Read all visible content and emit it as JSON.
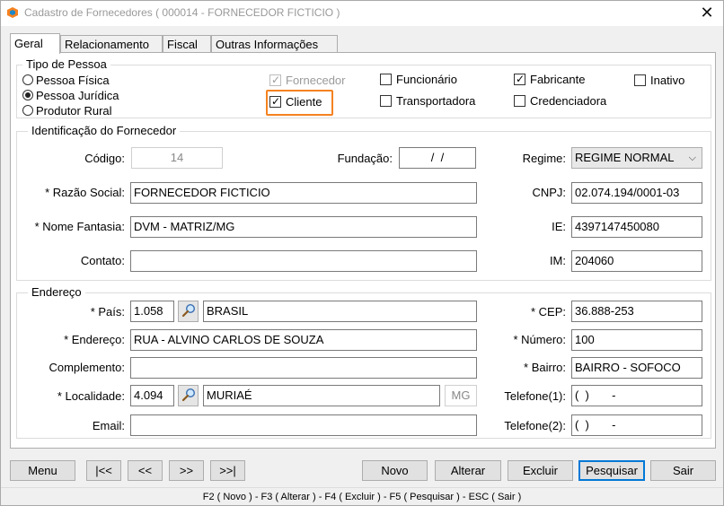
{
  "window": {
    "title": "Cadastro de Fornecedores ( 000014 - FORNECEDOR FICTICIO )"
  },
  "tabs": [
    {
      "label": "Geral",
      "active": true
    },
    {
      "label": "Relacionamento",
      "active": false
    },
    {
      "label": "Fiscal",
      "active": false
    },
    {
      "label": "Outras Informações",
      "active": false
    }
  ],
  "tipo_pessoa": {
    "legend": "Tipo de Pessoa",
    "options": [
      {
        "label": "Pessoa Física",
        "selected": false
      },
      {
        "label": "Pessoa Jurídica",
        "selected": true
      },
      {
        "label": "Produtor Rural",
        "selected": false
      }
    ]
  },
  "flags": {
    "fornecedor": {
      "label": "Fornecedor",
      "checked": true,
      "enabled": false
    },
    "cliente": {
      "label": "Cliente",
      "checked": true,
      "enabled": true
    },
    "funcionario": {
      "label": "Funcionário",
      "checked": false
    },
    "transportadora": {
      "label": "Transportadora",
      "checked": false
    },
    "fabricante": {
      "label": "Fabricante",
      "checked": true
    },
    "credenciadora": {
      "label": "Credenciadora",
      "checked": false
    },
    "inativo": {
      "label": "Inativo",
      "checked": false
    }
  },
  "identificacao": {
    "legend": "Identificação do Fornecedor",
    "codigo_label": "Código:",
    "codigo": "14",
    "fundacao_label": "Fundação:",
    "fundacao": " /  / ",
    "regime_label": "Regime:",
    "regime": "REGIME NORMAL",
    "razao_label": "* Razão Social:",
    "razao": "FORNECEDOR FICTICIO",
    "cnpj_label": "CNPJ:",
    "cnpj": "02.074.194/0001-03",
    "fantasia_label": "* Nome Fantasia:",
    "fantasia": "DVM - MATRIZ/MG",
    "ie_label": "IE:",
    "ie": "4397147450080",
    "contato_label": "Contato:",
    "contato": "",
    "im_label": "IM:",
    "im": "204060"
  },
  "endereco": {
    "legend": "Endereço",
    "pais_label": "* País:",
    "pais_codigo": "1.058",
    "pais_nome": "BRASIL",
    "cep_label": "* CEP:",
    "cep": "36.888-253",
    "endereco_label": "* Endereço:",
    "endereco": "RUA - ALVINO CARLOS DE SOUZA",
    "numero_label": "* Número:",
    "numero": "100",
    "complemento_label": "Complemento:",
    "complemento": "",
    "bairro_label": "* Bairro:",
    "bairro": "BAIRRO - SOFOCO",
    "localidade_label": "* Localidade:",
    "localidade_codigo": "4.094",
    "localidade_nome": "MURIAÉ",
    "uf": "MG",
    "telefone1_label": "Telefone(1):",
    "telefone1": "(  )       -",
    "email_label": "Email:",
    "email": "",
    "telefone2_label": "Telefone(2):",
    "telefone2": "(  )       -"
  },
  "buttons": {
    "menu": "Menu",
    "first": "|<<",
    "prev": "<<",
    "next": ">>",
    "last": ">>|",
    "novo": "Novo",
    "alterar": "Alterar",
    "excluir": "Excluir",
    "pesquisar": "Pesquisar",
    "sair": "Sair"
  },
  "footer": {
    "shortcuts": "F2 ( Novo )  -  F3 ( Alterar )  -  F4 ( Excluir )  -  F5 ( Pesquisar )  -  ESC ( Sair )"
  },
  "colors": {
    "highlight": "#f58220",
    "focus": "#0078d7"
  },
  "icons": {
    "app": "app-logo-icon",
    "search": "magnifier-icon",
    "close": "close-icon"
  }
}
